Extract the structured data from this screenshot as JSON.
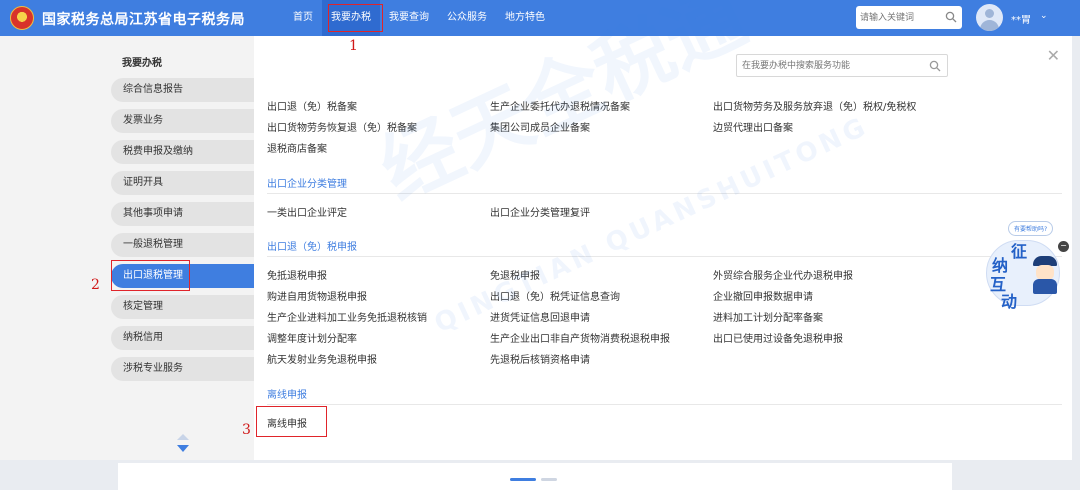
{
  "header": {
    "site_title": "国家税务总局江苏省电子税务局",
    "nav": [
      "首页",
      "我要办税",
      "我要查询",
      "公众服务",
      "地方特色"
    ],
    "search_placeholder": "请输入关键词",
    "user_name": "**胃"
  },
  "sidebar": {
    "title": "我要办税",
    "items": [
      "综合信息报告",
      "发票业务",
      "税费申报及缴纳",
      "证明开具",
      "其他事项申请",
      "一般退税管理",
      "出口退税管理",
      "核定管理",
      "纳税信用",
      "涉税专业服务"
    ],
    "active_item": "出口退税管理"
  },
  "panel": {
    "search_placeholder": "在我要办税中搜索服务功能",
    "top_links": [
      "出口退（免）税备案",
      "生产企业委托代办退税情况备案",
      "出口货物劳务及服务放弃退（免）税权/免税权",
      "出口货物劳务恢复退（免）税备案",
      "集团公司成员企业备案",
      "边贸代理出口备案",
      "退税商店备案"
    ],
    "sections": [
      {
        "title": "出口企业分类管理",
        "links": [
          "一类出口企业评定",
          "出口企业分类管理复评"
        ]
      },
      {
        "title": "出口退（免）税申报",
        "links": [
          "免抵退税申报",
          "免退税申报",
          "外贸综合服务企业代办退税申报",
          "购进自用货物退税申报",
          "出口退（免）税凭证信息查询",
          "企业撤回申报数据申请",
          "生产企业进料加工业务免抵退税核销",
          "进货凭证信息回退申请",
          "进料加工计划分配率备案",
          "调整年度计划分配率",
          "生产企业出口非自产货物消费税退税申报",
          "出口已使用过设备免退税申报",
          "航天发射业务免退税申报",
          "先退税后核销资格申请"
        ]
      },
      {
        "title": "离线申报",
        "links": [
          "离线申报"
        ]
      }
    ]
  },
  "annotations": [
    "1",
    "2",
    "3"
  ],
  "watermark": {
    "cn": "经天全税通",
    "en": "QINGTIAN QUANSHUITONG"
  },
  "help_widget": {
    "bubble": "有要帮助吗?",
    "chars": [
      "征",
      "纳",
      "互",
      "动"
    ],
    "close": "−"
  },
  "colors": {
    "brand_blue": "#3f7ee0",
    "annotation_red": "#e0242a"
  }
}
